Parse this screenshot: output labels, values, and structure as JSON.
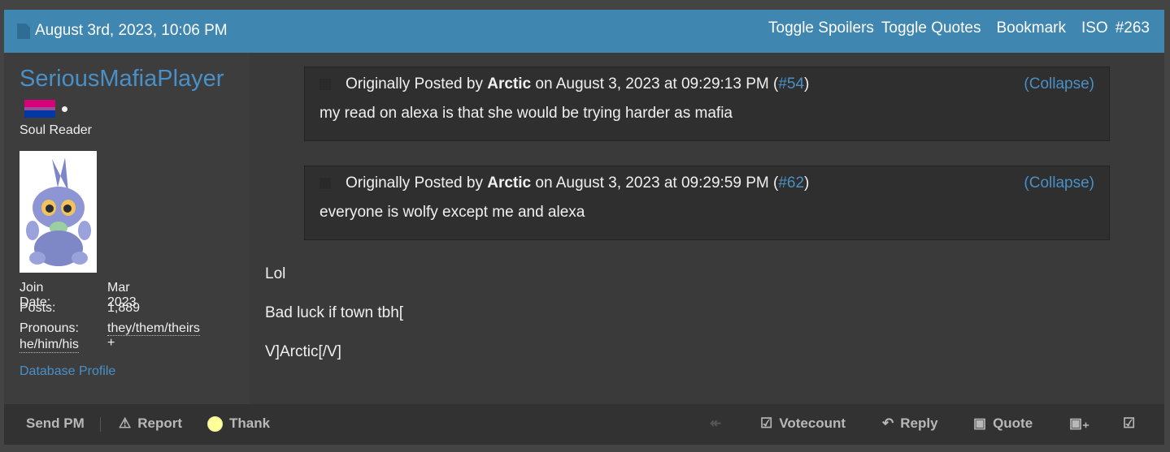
{
  "header": {
    "date": "August 3rd, 2023, 10:06 PM",
    "actions": [
      "Toggle Spoilers",
      "Toggle Quotes",
      "Bookmark",
      "ISO",
      "#263"
    ]
  },
  "user": {
    "name": "SeriousMafiaPlayer",
    "title": "Soul Reader",
    "stats": [
      {
        "key": "Join Date:",
        "value": "Mar 2023"
      },
      {
        "key": "Posts:",
        "value": "1,889"
      },
      {
        "key": "Pronouns:",
        "value_a": "they/them/theirs",
        "value_b": " + ",
        "value_c": "he/him/his"
      }
    ],
    "profile_link": "Database Profile"
  },
  "quotes": [
    {
      "prefix": "Originally Posted by ",
      "author": "Arctic",
      "middle": " on August 3, 2023 at 09:29:13 PM (",
      "post_link": "#54",
      "suffix": ")",
      "collapse": "(Collapse)",
      "text": "my read on alexa is that she would be trying harder as mafia"
    },
    {
      "prefix": "Originally Posted by ",
      "author": "Arctic",
      "middle": " on August 3, 2023 at 09:29:59 PM (",
      "post_link": "#62",
      "suffix": ")",
      "collapse": "(Collapse)",
      "text": "everyone is wolfy except me and alexa"
    }
  ],
  "message": [
    "Lol",
    "Bad luck if town tbh[",
    "V]Arctic[/V]"
  ],
  "footer": {
    "send_pm": "Send PM",
    "report": "Report",
    "thank": "Thank",
    "votecount": "Votecount",
    "reply": "Reply",
    "quote": "Quote"
  },
  "colors": {
    "header": "#3f86b0",
    "link": "#4a90c6",
    "background": "#3a3a3a"
  }
}
